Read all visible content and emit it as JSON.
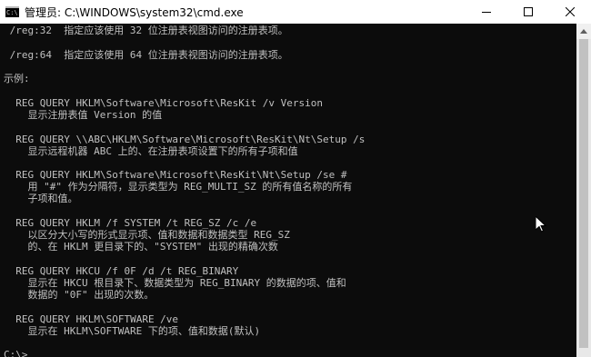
{
  "window": {
    "title": "管理员: C:\\WINDOWS\\system32\\cmd.exe",
    "icon_label": "C:\\"
  },
  "console": {
    "lines": [
      " /reg:32  指定应该使用 32 位注册表视图访问的注册表项。",
      " /reg:64  指定应该使用 64 位注册表视图访问的注册表项。",
      "示例:",
      "  REG QUERY HKLM\\Software\\Microsoft\\ResKit /v Version",
      "    显示注册表值 Version 的值",
      "  REG QUERY \\\\ABC\\HKLM\\Software\\Microsoft\\ResKit\\Nt\\Setup /s",
      "    显示远程机器 ABC 上的、在注册表项设置下的所有子项和值",
      "  REG QUERY HKLM\\Software\\Microsoft\\ResKit\\Nt\\Setup /se #",
      "    用 \"#\" 作为分隔符，显示类型为 REG_MULTI_SZ 的所有值名称的所有",
      "    子项和值。",
      "  REG QUERY HKLM /f SYSTEM /t REG_SZ /c /e",
      "    以区分大小写的形式显示项、值和数据和数据类型 REG_SZ",
      "    的、在 HKLM 更目录下的、\"SYSTEM\" 出现的精确次数",
      "  REG QUERY HKCU /f 0F /d /t REG_BINARY",
      "    显示在 HKCU 根目录下、数据类型为 REG_BINARY 的数据的项、值和",
      "    数据的 \"0F\" 出现的次数。",
      "  REG QUERY HKLM\\SOFTWARE /ve",
      "    显示在 HKLM\\SOFTWARE 下的项、值和数据(默认)",
      "C:\\>"
    ]
  },
  "colors": {
    "console_bg": "#0c0c0c",
    "console_fg": "#c0c0c0",
    "titlebar_bg": "#ffffff"
  },
  "icons": {
    "minimize": "minimize-icon",
    "maximize": "maximize-icon",
    "close": "close-icon",
    "scroll_up": "scroll-up-arrow-icon",
    "cursor": "mouse-pointer-icon"
  }
}
